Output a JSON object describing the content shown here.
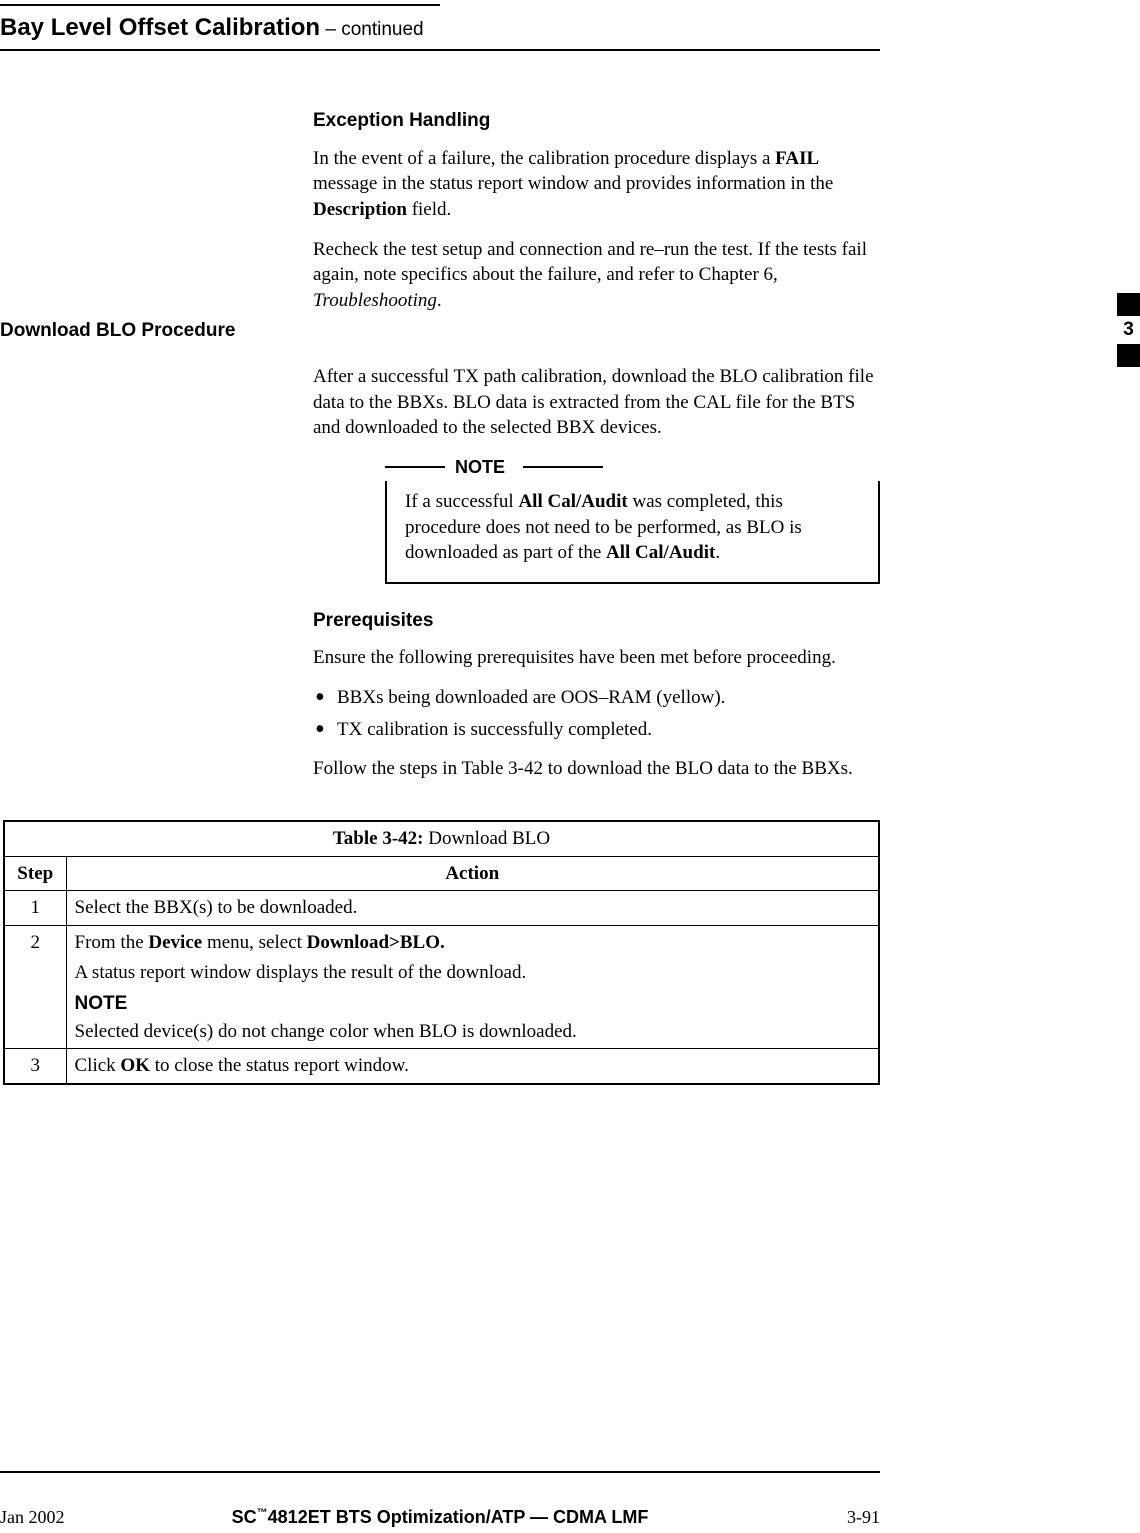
{
  "header": {
    "title": "Bay Level Offset Calibration",
    "continued": " – continued"
  },
  "tab": {
    "chapter": "3"
  },
  "sections": {
    "exception": {
      "heading": "Exception Handling",
      "p1_a": "In the event of a failure, the calibration procedure displays a ",
      "p1_b": "FAIL",
      "p1_c": " message in the status report window and provides information in the ",
      "p1_d": "Description",
      "p1_e": " field.",
      "p2_a": "Recheck the test setup and connection and re–run the test. If the tests fail again, note specifics about the failure, and refer to Chapter 6, ",
      "p2_b": "Troubleshooting",
      "p2_c": "."
    },
    "download": {
      "side_heading": "Download BLO Procedure",
      "p1": "After a successful TX path calibration, download the BLO calibration file data to the BBXs. BLO data is extracted from the CAL file for the BTS and downloaded to the selected BBX devices.",
      "note_label": "NOTE",
      "note_a": "If a successful ",
      "note_b": "All Cal/Audit",
      "note_c": " was completed, this procedure does not need to be performed, as BLO is downloaded as part of the ",
      "note_d": "All Cal/Audit",
      "note_e": "."
    },
    "prereq": {
      "heading": "Prerequisites",
      "p1": "Ensure the following prerequisites have been met before proceeding.",
      "bullets": [
        "BBXs being downloaded are OOS–RAM (yellow).",
        "TX calibration is successfully completed."
      ],
      "p2": "Follow the steps in Table 3-42 to download the BLO data to the BBXs."
    }
  },
  "table": {
    "caption_a": "Table 3-42:",
    "caption_b": " Download BLO",
    "head_step": "Step",
    "head_action": "Action",
    "rows": [
      {
        "step": "1",
        "a": "Select the BBX(s) to be downloaded."
      },
      {
        "step": "2",
        "a": "From the ",
        "b": "Device",
        "c": " menu, select ",
        "d": "Download>BLO.",
        "e": "A status report window displays the result of the download.",
        "f": "NOTE",
        "g": "Selected device(s) do not change color when BLO is downloaded."
      },
      {
        "step": "3",
        "a": "Click ",
        "b": "OK",
        "c": " to close the status report window."
      }
    ]
  },
  "footer": {
    "left": "Jan 2002",
    "center_a": "SC",
    "center_tm": "™",
    "center_b": "4812ET BTS Optimization/ATP — CDMA LMF",
    "right": "3-91"
  }
}
